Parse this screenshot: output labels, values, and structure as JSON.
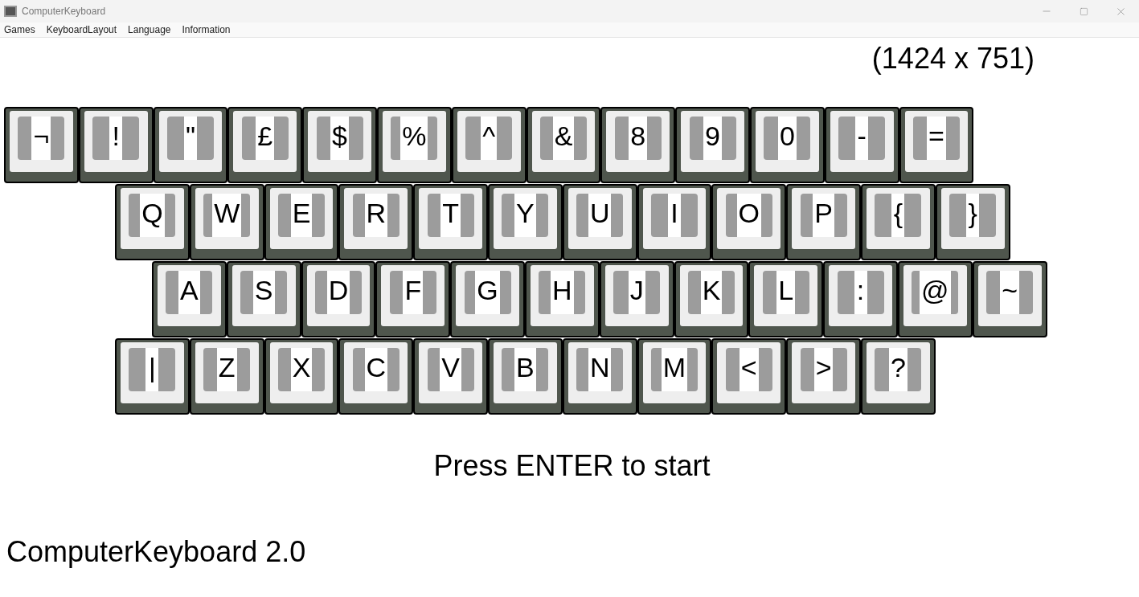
{
  "window": {
    "title": "ComputerKeyboard"
  },
  "menu": [
    "Games",
    "KeyboardLayout",
    "Language",
    "Information"
  ],
  "size_label": "(1424 x 751)",
  "keyboard": {
    "rows": [
      {
        "keys": [
          {
            "label": "¬"
          },
          {
            "label": "!"
          },
          {
            "label": "\""
          },
          {
            "label": "£"
          },
          {
            "label": "$"
          },
          {
            "label": "%"
          },
          {
            "label": "^"
          },
          {
            "label": "&"
          },
          {
            "label": "8"
          },
          {
            "label": "9"
          },
          {
            "label": "0"
          },
          {
            "label": "-"
          },
          {
            "label": "="
          }
        ]
      },
      {
        "keys": [
          {
            "label": "Q"
          },
          {
            "label": "W"
          },
          {
            "label": "E"
          },
          {
            "label": "R"
          },
          {
            "label": "T"
          },
          {
            "label": "Y"
          },
          {
            "label": "U"
          },
          {
            "label": "I"
          },
          {
            "label": "O"
          },
          {
            "label": "P"
          },
          {
            "label": "{"
          },
          {
            "label": "}"
          }
        ]
      },
      {
        "keys": [
          {
            "label": "A"
          },
          {
            "label": "S"
          },
          {
            "label": "D"
          },
          {
            "label": "F"
          },
          {
            "label": "G"
          },
          {
            "label": "H"
          },
          {
            "label": "J"
          },
          {
            "label": "K"
          },
          {
            "label": "L"
          },
          {
            "label": ":"
          },
          {
            "label": "@"
          },
          {
            "label": "~"
          }
        ]
      },
      {
        "keys": [
          {
            "label": "|"
          },
          {
            "label": "Z"
          },
          {
            "label": "X"
          },
          {
            "label": "C"
          },
          {
            "label": "V"
          },
          {
            "label": "B"
          },
          {
            "label": "N"
          },
          {
            "label": "M"
          },
          {
            "label": "<"
          },
          {
            "label": ">"
          },
          {
            "label": "?"
          }
        ]
      }
    ]
  },
  "prompt": "Press ENTER to start",
  "version": "ComputerKeyboard 2.0"
}
